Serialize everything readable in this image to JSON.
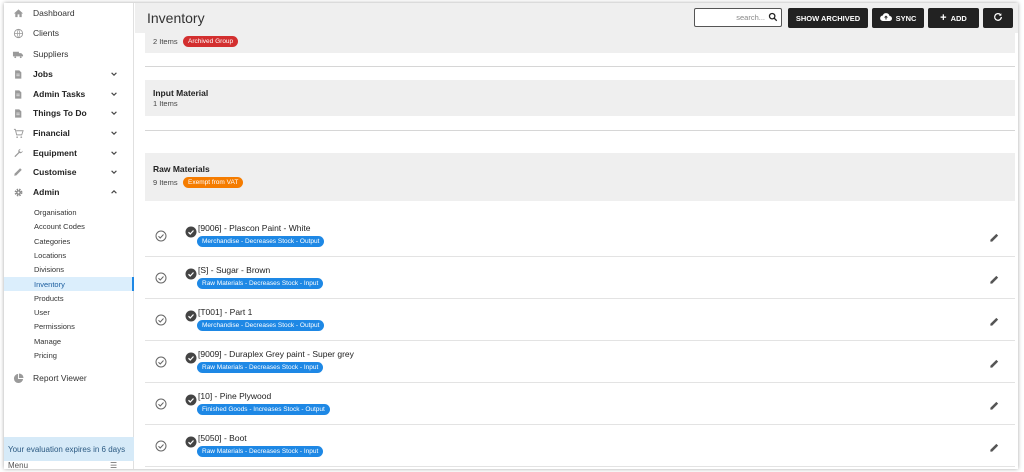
{
  "sidebar": {
    "items": [
      {
        "label": "Dashboard",
        "icon": "home-icon",
        "bold": false
      },
      {
        "label": "Clients",
        "icon": "globe-icon",
        "bold": false
      },
      {
        "label": "Suppliers",
        "icon": "truck-icon",
        "bold": false
      },
      {
        "label": "Jobs",
        "icon": "document-icon",
        "bold": true,
        "chevron": "down"
      },
      {
        "label": "Admin Tasks",
        "icon": "document-icon",
        "bold": true,
        "chevron": "down"
      },
      {
        "label": "Things To Do",
        "icon": "document-icon",
        "bold": true,
        "chevron": "down"
      },
      {
        "label": "Financial",
        "icon": "cart-icon",
        "bold": true,
        "chevron": "down"
      },
      {
        "label": "Equipment",
        "icon": "wrench-icon",
        "bold": true,
        "chevron": "down"
      },
      {
        "label": "Customise",
        "icon": "pencil-icon",
        "bold": true,
        "chevron": "down"
      },
      {
        "label": "Admin",
        "icon": "gear-icon",
        "bold": true,
        "chevron": "up"
      }
    ],
    "admin_sub": [
      "Organisation",
      "Account Codes",
      "Categories",
      "Locations",
      "Divisions",
      "Inventory",
      "Products",
      "User",
      "Permissions",
      "Manage",
      "Pricing"
    ],
    "active_sub": "Inventory",
    "report_viewer": "Report Viewer",
    "eval_banner": "Your evaluation expires in 6 days",
    "menu_label": "Menu"
  },
  "header": {
    "title": "Inventory",
    "search_placeholder": "search...",
    "show_archived": "SHOW ARCHIVED",
    "sync": "SYNC",
    "add": "ADD"
  },
  "groups": [
    {
      "title": "",
      "count": "2 Items",
      "badge": "Archived Group",
      "badge_color": "#d32f2f"
    },
    {
      "title": "Input Material",
      "count": "1 Items",
      "badge": "",
      "badge_color": ""
    },
    {
      "title": "Raw Materials",
      "count": "9 Items",
      "badge": "Exempt from VAT",
      "badge_color": "#f57c00"
    }
  ],
  "items": [
    {
      "name": "[9006] - Plascon Paint - White",
      "badge": "Merchandise - Decreases Stock - Output"
    },
    {
      "name": "[S] - Sugar - Brown",
      "badge": "Raw Materials - Decreases Stock - Input"
    },
    {
      "name": "[T001] - Part 1",
      "badge": "Merchandise - Decreases Stock - Output"
    },
    {
      "name": "[9009] - Duraplex Grey paint - Super grey",
      "badge": "Raw Materials - Decreases Stock - Input"
    },
    {
      "name": "[10] - Pine Plywood",
      "badge": "Finished Goods - Increases Stock - Output"
    },
    {
      "name": "[5050] - Boot",
      "badge": "Raw Materials - Decreases Stock - Input"
    }
  ],
  "colors": {
    "accent": "#1e88e5",
    "toolbar_button": "#222222",
    "group_bg": "#efefef"
  }
}
